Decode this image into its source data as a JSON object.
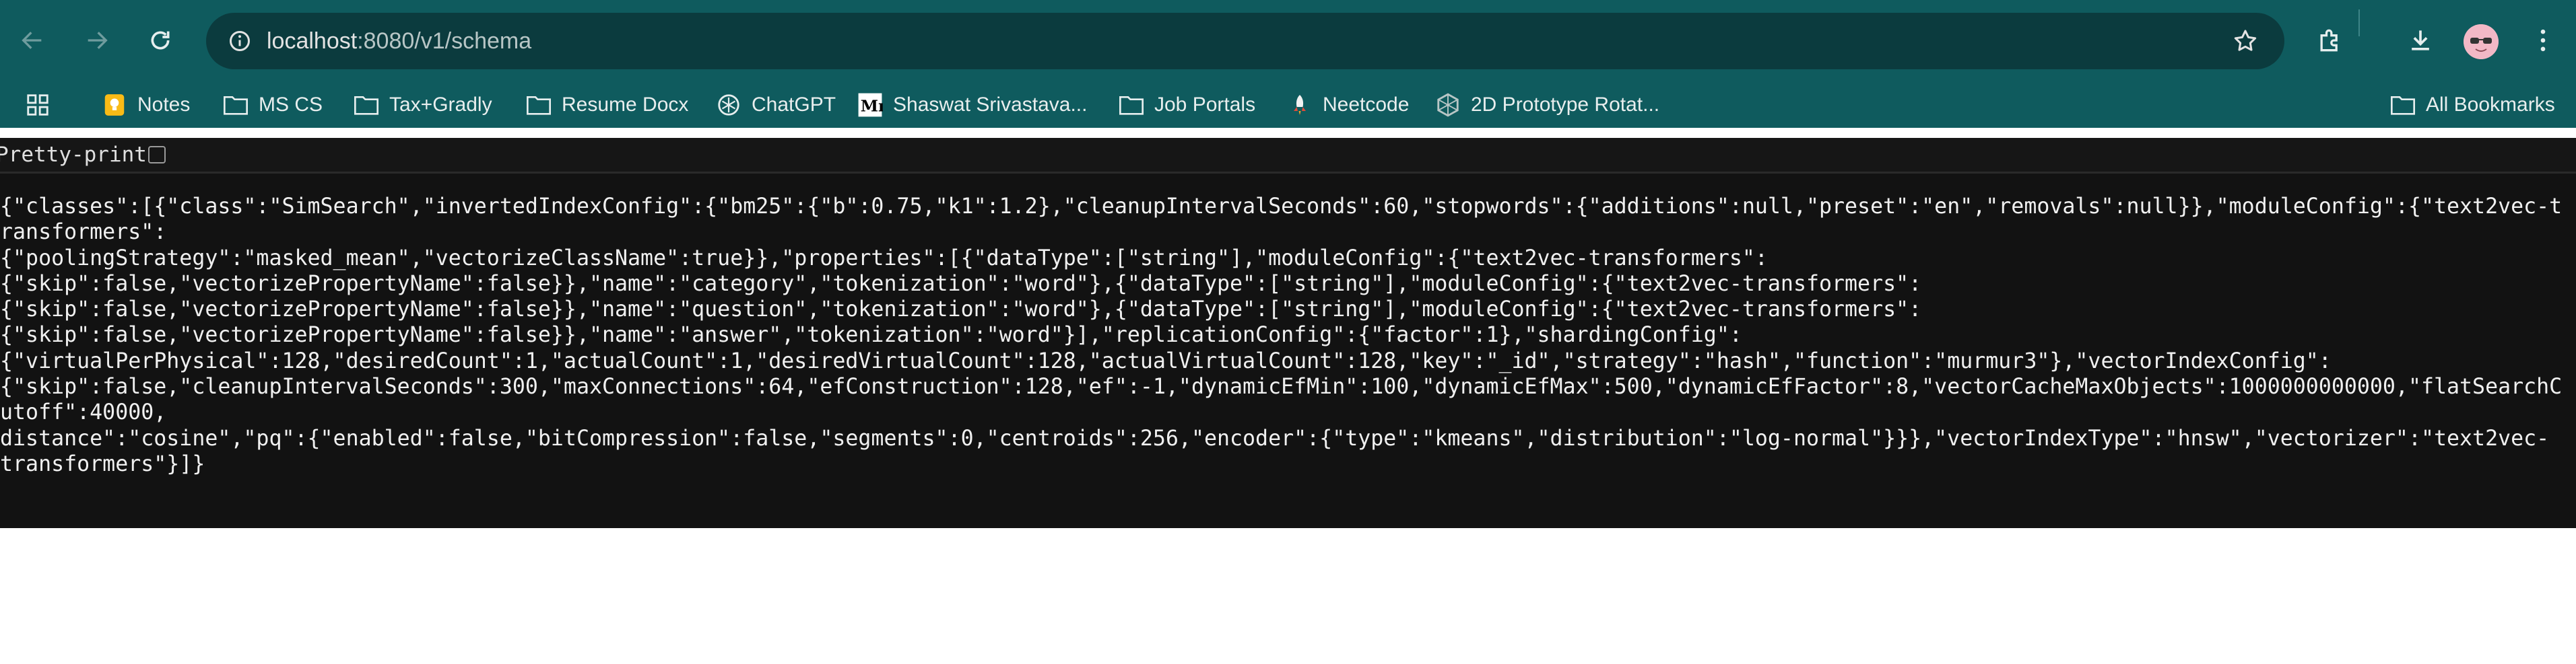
{
  "browser": {
    "url_host": "localhost",
    "url_path": ":8080/v1/schema",
    "colors": {
      "frame": "#0f5b5e",
      "omnibox": "#0b3b3e",
      "content_bg": "#121212"
    },
    "toolbar_icons": [
      "back-icon",
      "forward-icon",
      "reload-icon",
      "site-info-icon",
      "star-icon",
      "extensions-icon",
      "download-icon",
      "avatar",
      "menu-icon"
    ]
  },
  "bookmarks": {
    "items": [
      {
        "label": "Notes",
        "icon": "notes-icon"
      },
      {
        "label": "MS CS",
        "icon": "folder-icon"
      },
      {
        "label": "Tax+Gradly",
        "icon": "folder-icon"
      },
      {
        "label": "Resume Docx",
        "icon": "folder-icon"
      },
      {
        "label": "ChatGPT",
        "icon": "chatgpt-icon"
      },
      {
        "label": "Shaswat Srivastava...",
        "icon": "medium-icon"
      },
      {
        "label": "Job Portals",
        "icon": "folder-icon"
      },
      {
        "label": "Neetcode",
        "icon": "rocket-icon"
      },
      {
        "label": "2D Prototype Rotat...",
        "icon": "globe-icon"
      }
    ],
    "all_bookmarks_label": "All Bookmarks"
  },
  "viewer": {
    "pretty_print_label": "Pretty-print",
    "pretty_print_checked": false
  },
  "json_lines": [
    "{\"classes\":[{\"class\":\"SimSearch\",\"invertedIndexConfig\":{\"bm25\":{\"b\":0.75,\"k1\":1.2},\"cleanupIntervalSeconds\":60,\"stopwords\":{\"additions\":null,\"preset\":\"en\",\"removals\":null}},\"moduleConfig\":{\"text2vec-transformers\":",
    "{\"poolingStrategy\":\"masked_mean\",\"vectorizeClassName\":true}},\"properties\":[{\"dataType\":[\"string\"],\"moduleConfig\":{\"text2vec-transformers\":",
    "{\"skip\":false,\"vectorizePropertyName\":false}},\"name\":\"category\",\"tokenization\":\"word\"},{\"dataType\":[\"string\"],\"moduleConfig\":{\"text2vec-transformers\":",
    "{\"skip\":false,\"vectorizePropertyName\":false}},\"name\":\"question\",\"tokenization\":\"word\"},{\"dataType\":[\"string\"],\"moduleConfig\":{\"text2vec-transformers\":",
    "{\"skip\":false,\"vectorizePropertyName\":false}},\"name\":\"answer\",\"tokenization\":\"word\"}],\"replicationConfig\":{\"factor\":1},\"shardingConfig\":",
    "{\"virtualPerPhysical\":128,\"desiredCount\":1,\"actualCount\":1,\"desiredVirtualCount\":128,\"actualVirtualCount\":128,\"key\":\"_id\",\"strategy\":\"hash\",\"function\":\"murmur3\"},\"vectorIndexConfig\":",
    "{\"skip\":false,\"cleanupIntervalSeconds\":300,\"maxConnections\":64,\"efConstruction\":128,\"ef\":-1,\"dynamicEfMin\":100,\"dynamicEfMax\":500,\"dynamicEfFactor\":8,\"vectorCacheMaxObjects\":1000000000000,\"flatSearchCutoff\":40000,",
    "distance\":\"cosine\",\"pq\":{\"enabled\":false,\"bitCompression\":false,\"segments\":0,\"centroids\":256,\"encoder\":{\"type\":\"kmeans\",\"distribution\":\"log-normal\"}}},\"vectorIndexType\":\"hnsw\",\"vectorizer\":\"text2vec-",
    "transformers\"}]}"
  ]
}
